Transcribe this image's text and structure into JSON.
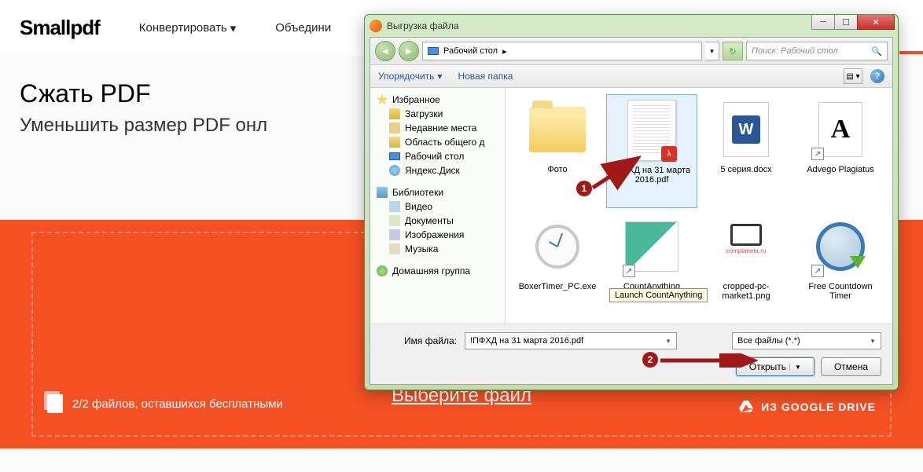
{
  "page": {
    "logo": "Smallpdf",
    "nav": {
      "convert": "Конвертировать",
      "merge": "Объедини"
    },
    "hero": {
      "title": "Сжать PDF",
      "subtitle": "Уменьшить размер PDF онл"
    },
    "select_file": "Выберите файл",
    "files_left": "2/2 файлов, оставшихся бесплатными",
    "gdrive": "ИЗ GOOGLE DRIVE"
  },
  "dialog": {
    "title": "Выгрузка файла",
    "breadcrumb": "Рабочий стол",
    "search_placeholder": "Поиск: Рабочий стол",
    "toolbar": {
      "organize": "Упорядочить",
      "new_folder": "Новая папка"
    },
    "sidebar": {
      "favorites": {
        "label": "Избранное",
        "items": [
          "Загрузки",
          "Недавние места",
          "Область общего д",
          "Рабочий стол",
          "Яндекс.Диск"
        ]
      },
      "libraries": {
        "label": "Библиотеки",
        "items": [
          "Видео",
          "Документы",
          "Изображения",
          "Музыка"
        ]
      },
      "homegroup": "Домашняя группа"
    },
    "files": [
      {
        "name": "Фото"
      },
      {
        "name": "!ПФХД на 31 марта 2016.pdf"
      },
      {
        "name": "5 серия.docx"
      },
      {
        "name": "Advego Plagiatus"
      },
      {
        "name": "BoxerTimer_PC.exe"
      },
      {
        "name": "CountAnything"
      },
      {
        "name": "cropped-pc-market1.png"
      },
      {
        "name": "Free Countdown Timer"
      }
    ],
    "tooltip": "Launch CountAnything",
    "complaneta_text": "complaneta.ru",
    "filename_label": "Имя файла:",
    "filename_value": "!ПФХД на 31 марта 2016.pdf",
    "filetype": "Все файлы (*.*)",
    "open": "Открыть",
    "cancel": "Отмена"
  },
  "annotations": {
    "step1": "1",
    "step2": "2"
  }
}
